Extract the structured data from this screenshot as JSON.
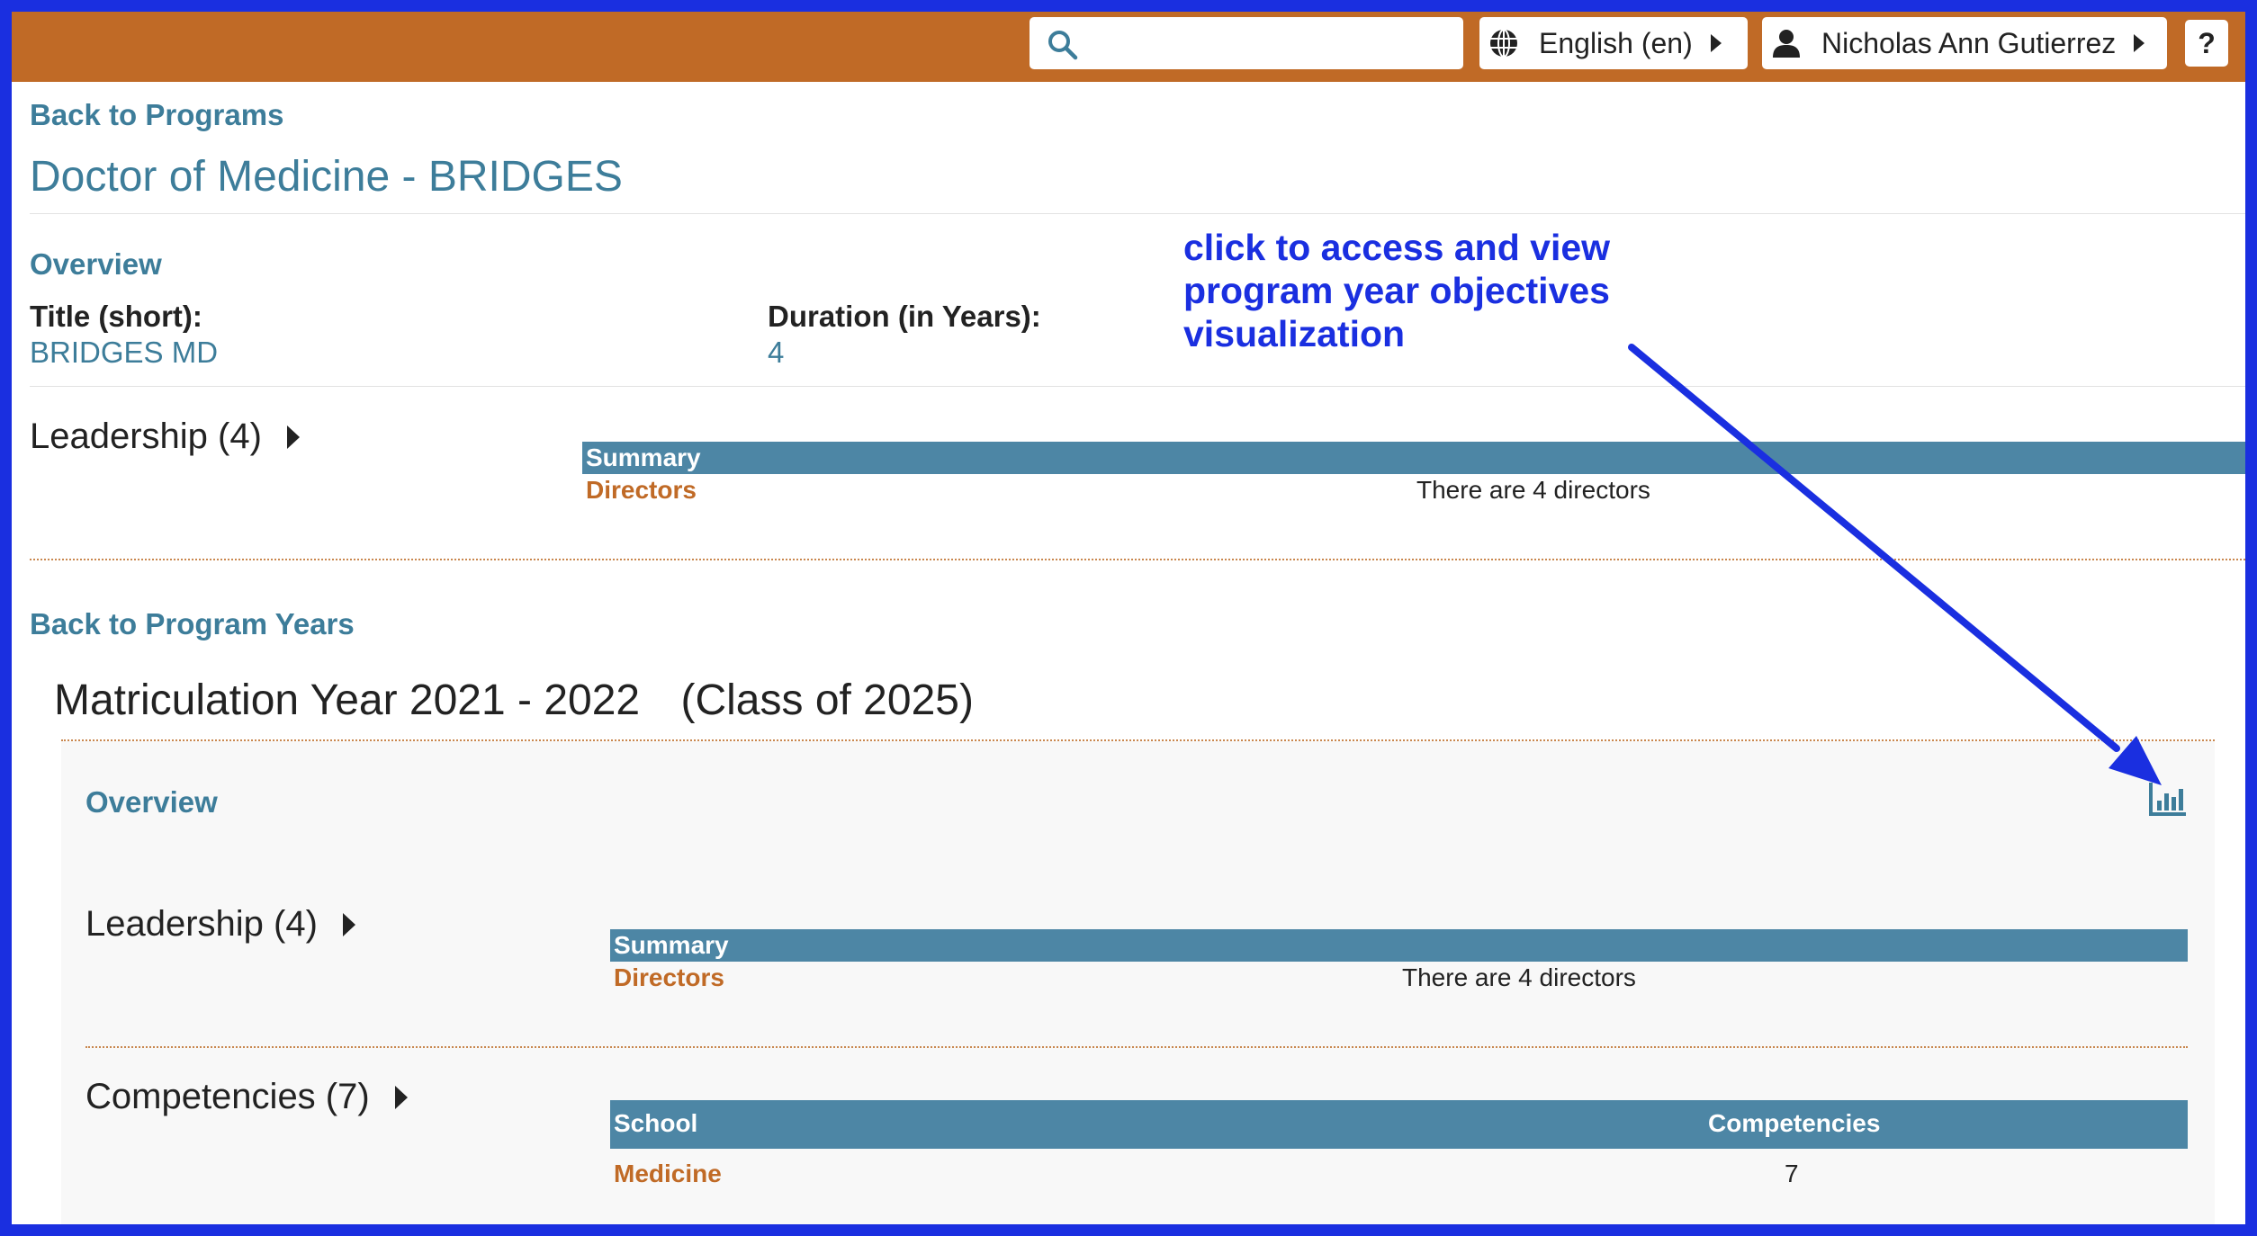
{
  "topbar": {
    "search": {
      "placeholder": "",
      "value": ""
    },
    "language_label": "English (en)",
    "user_name": "Nicholas Ann Gutierrez",
    "help_label": "?"
  },
  "program": {
    "back_link": "Back to Programs",
    "title": "Doctor of Medicine - BRIDGES",
    "overview_label": "Overview",
    "short_title_label": "Title (short):",
    "short_title_value": "BRIDGES MD",
    "duration_label": "Duration (in Years):",
    "duration_value": "4",
    "leadership": {
      "label": "Leadership (4)",
      "table_header": "Summary",
      "row_label": "Directors",
      "row_value": "There are 4 directors"
    }
  },
  "program_year": {
    "back_link": "Back to Program Years",
    "title": "Matriculation Year 2021 - 2022",
    "class_label": "(Class of 2025)",
    "overview_label": "Overview",
    "viz_icon": "bar-chart-icon",
    "leadership": {
      "label": "Leadership (4)",
      "table_header": "Summary",
      "row_label": "Directors",
      "row_value": "There are 4 directors"
    },
    "competencies": {
      "label": "Competencies (7)",
      "headers": [
        "School",
        "Competencies"
      ],
      "rows": [
        {
          "school": "Medicine",
          "count": "7"
        }
      ]
    }
  },
  "annotation": {
    "lines": [
      "click to access and view",
      "program year objectives",
      "visualization"
    ],
    "color": "#1a2fe0"
  },
  "colors": {
    "topbar": "#c06a26",
    "link": "#3d7d9a",
    "table_header": "#4d86a5",
    "accent_link": "#c06a26",
    "frame_border": "#1a2fe0"
  }
}
